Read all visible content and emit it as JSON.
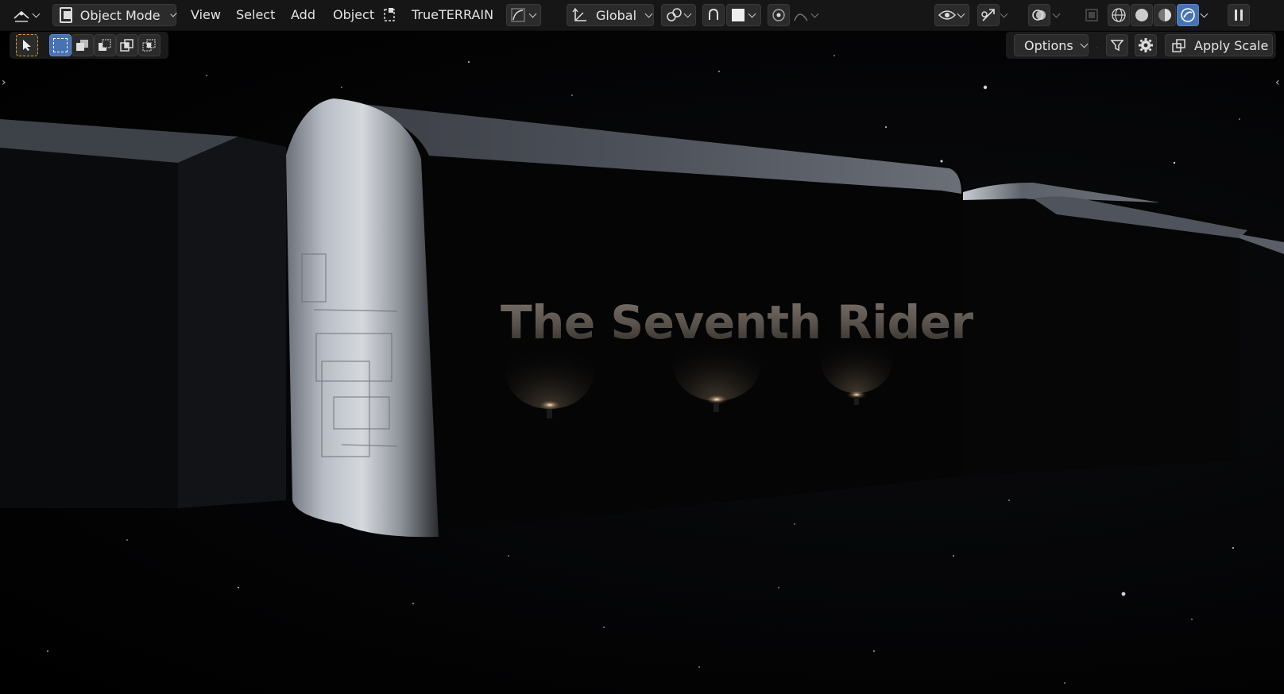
{
  "header": {
    "editor_type_icon": "editor-type-icon",
    "mode_label": "Object Mode",
    "menus": [
      "View",
      "Select",
      "Add",
      "Object"
    ],
    "addon_label": "TrueTERRAIN",
    "transform_orientation": "Global"
  },
  "tool_header": {
    "options_label": "Options",
    "apply_scale_label": "Apply Scale"
  },
  "scene": {
    "decal_text": "The Seventh Rider"
  },
  "colors": {
    "header_bg": "#181818",
    "button_bg": "#2b2b2b",
    "accent": "#4772b3",
    "hull_highlight": "#c9ced6"
  }
}
